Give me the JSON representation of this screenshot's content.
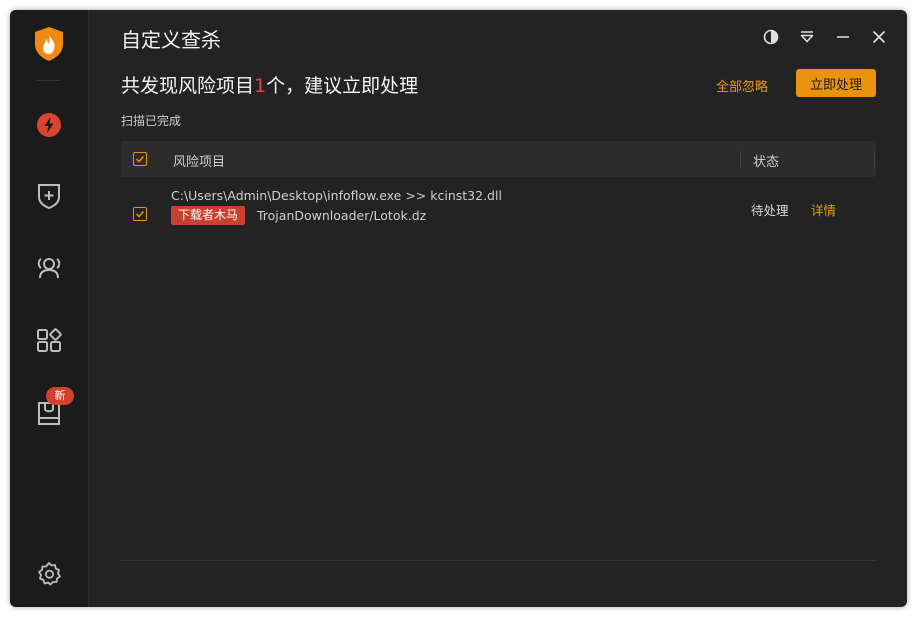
{
  "window": {
    "title": "自定义查杀"
  },
  "sidebar": {
    "logo": "flame-shield-logo",
    "items": [
      {
        "name": "lightning-icon"
      },
      {
        "name": "shield-plus-icon"
      },
      {
        "name": "users-icon"
      },
      {
        "name": "apps-grid-icon"
      },
      {
        "name": "box-icon",
        "badge": "新"
      }
    ],
    "settings": "gear-icon"
  },
  "header": {
    "headline_prefix": "共发现风险项目",
    "headline_count": "1",
    "headline_suffix": "个，建议立即处理",
    "scan_status": "扫描已完成",
    "ignore_all": "全部忽略",
    "handle_now": "立即处理"
  },
  "table": {
    "columns": [
      "风险项目",
      "状态"
    ],
    "rows": [
      {
        "path": "C:\\Users\\Admin\\Desktop\\infoflow.exe >> kcinst32.dll",
        "tag": "下载者木马",
        "virus": "TrojanDownloader/Lotok.dz",
        "status": "待处理",
        "action": "详情"
      }
    ]
  },
  "colors": {
    "accent": "#e8920e",
    "danger": "#e8433a",
    "background": "#232323"
  }
}
